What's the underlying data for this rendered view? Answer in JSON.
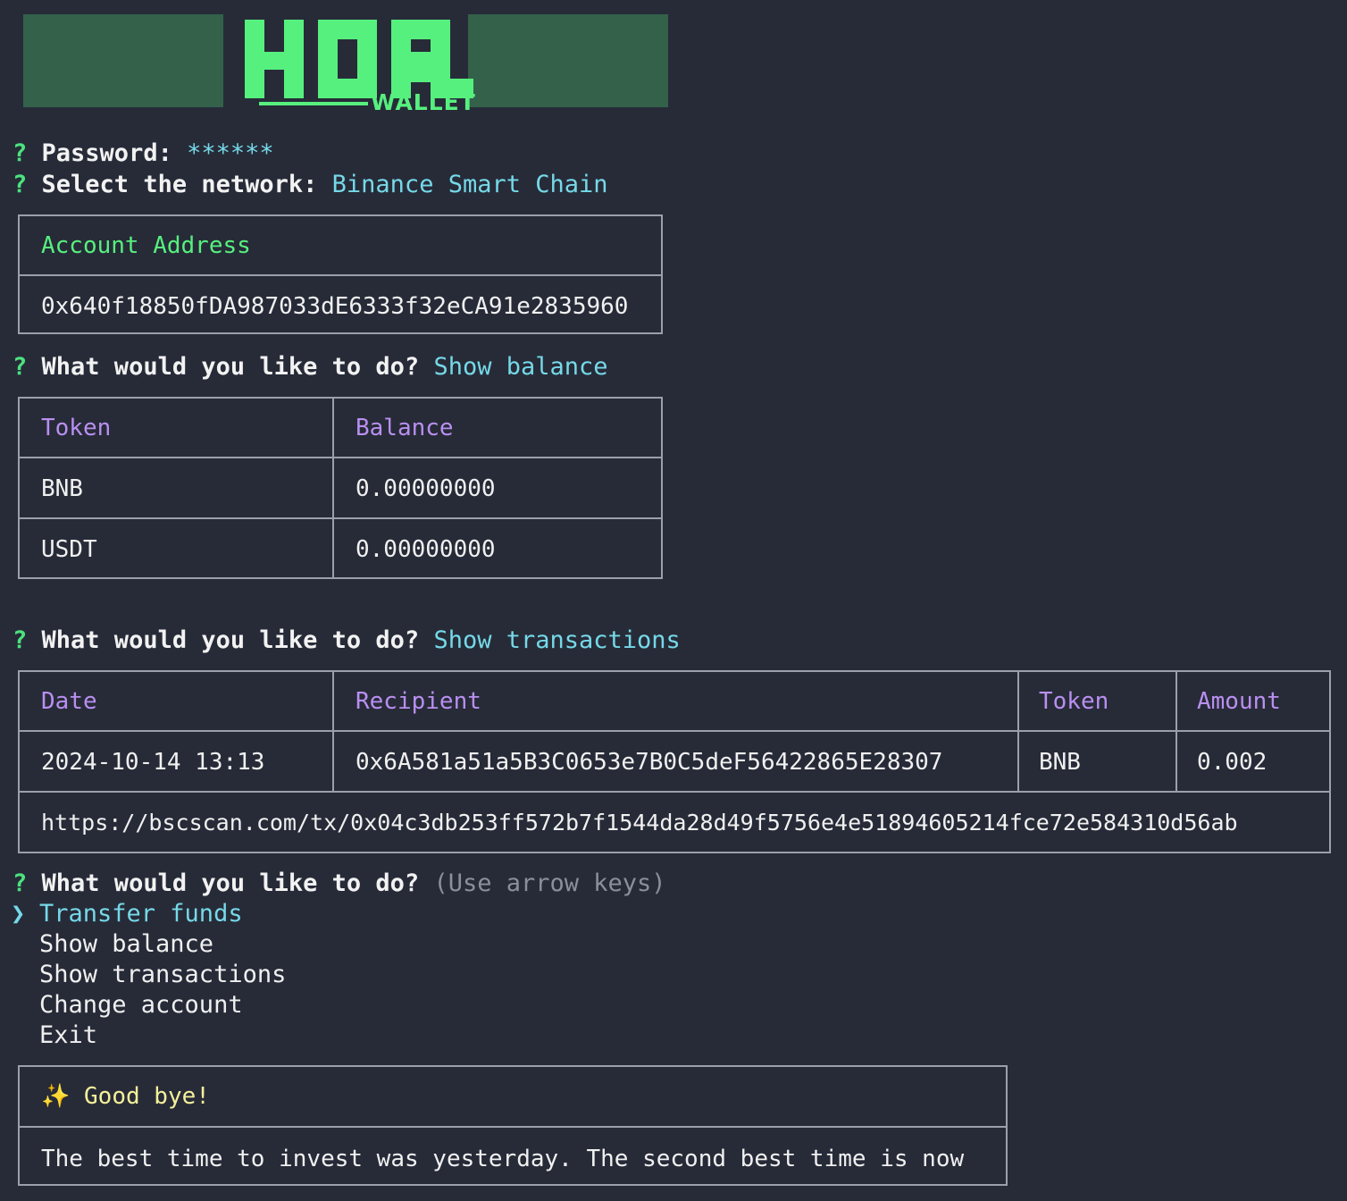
{
  "terminal": {
    "background": "#272b38",
    "foreground": "#e6e6e6",
    "accent_green": "#56f07e",
    "accent_cyan": "#76d9e8",
    "accent_purple": "#b98ff0",
    "accent_yellow": "#f5f09a",
    "border": "#9aa0ab",
    "logo_block": "#33614a"
  },
  "logo": {
    "title": "HODL",
    "subtitle": "WALLET"
  },
  "prompts": {
    "password": {
      "marker": "?",
      "label": "Password:",
      "value": "******"
    },
    "network": {
      "marker": "?",
      "label": "Select the network:",
      "value": "Binance Smart Chain"
    },
    "action_balance": {
      "marker": "?",
      "label": "What would you like to do?",
      "value": "Show balance"
    },
    "action_transactions": {
      "marker": "?",
      "label": "What would you like to do?",
      "value": "Show transactions"
    },
    "action_menu": {
      "marker": "?",
      "label": "What would you like to do?",
      "hint": "(Use arrow keys)"
    }
  },
  "account_panel": {
    "header": "Account Address",
    "address": "0x640f18850fDA987033dE6333f32eCA91e2835960"
  },
  "balance_table": {
    "columns": [
      "Token",
      "Balance"
    ],
    "rows": [
      {
        "token": "BNB",
        "balance": "0.00000000"
      },
      {
        "token": "USDT",
        "balance": "0.00000000"
      }
    ]
  },
  "transactions_table": {
    "columns": [
      "Date",
      "Recipient",
      "Token",
      "Amount"
    ],
    "rows": [
      {
        "date": "2024-10-14 13:13",
        "recipient": "0x6A581a51a5B3C0653e7B0C5deF56422865E28307",
        "token": "BNB",
        "amount": "0.002"
      }
    ],
    "explorer_url": "https://bscscan.com/tx/0x04c3db253ff572b7f1544da28d49f5756e4e51894605214fce72e584310d56ab"
  },
  "menu": {
    "pointer": "❯",
    "items": [
      {
        "label": "Transfer funds",
        "selected": true
      },
      {
        "label": "Show balance",
        "selected": false
      },
      {
        "label": "Show transactions",
        "selected": false
      },
      {
        "label": "Change account",
        "selected": false
      },
      {
        "label": "Exit",
        "selected": false
      }
    ]
  },
  "goodbye_panel": {
    "sparkle": "✨",
    "title": "Good bye!",
    "quote": "The best time to invest was yesterday. The second best time is now"
  }
}
